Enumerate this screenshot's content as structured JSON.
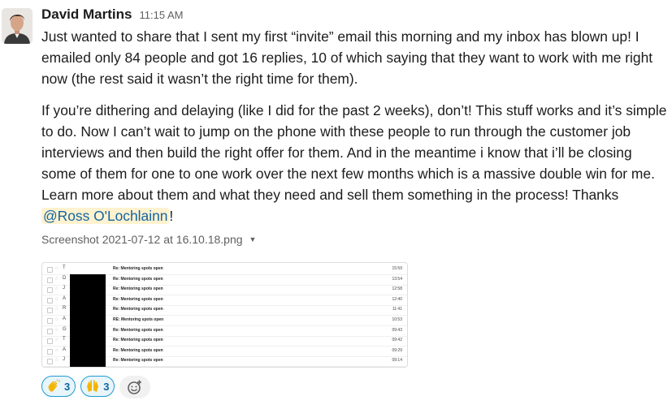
{
  "message": {
    "author": "David Martins",
    "timestamp": "11:15 AM",
    "paragraph1": "Just wanted to share that I sent my first “invite” email this morning and my inbox has blown up! I emailed only 84 people and got 16 replies, 10 of which saying that they want to work with me right now (the rest said it wasn’t the right time for them).",
    "paragraph2": "If you’re dithering and delaying (like I did for the past 2 weeks), don’t! This stuff works and it’s simple to do. Now I can’t wait to jump on the phone with these people to run through the customer job interviews and then build the right offer for them. And in the meantime i know that i’ll be closing some of them for one to one work over the next few months which is a massive double win for me. Learn more about them and what they need and sell them something in the process! Thanks ",
    "mention": "@Ross O'Lochlainn",
    "trailing": "!"
  },
  "attachment": {
    "filename": "Screenshot 2021-07-12 at 16.10.18.png",
    "rows": [
      {
        "init": "T",
        "subject": "Re: Mentoring spots open",
        "time": "15:59"
      },
      {
        "init": "D",
        "subject": "Re: Mentoring spots open",
        "time": "13:54"
      },
      {
        "init": "J",
        "subject": "Re: Mentoring spots open",
        "time": "12:58"
      },
      {
        "init": "A",
        "subject": "Re: Mentoring spots open",
        "time": "12:40"
      },
      {
        "init": "R",
        "subject": "Re: Mentoring spots open",
        "time": "11:41"
      },
      {
        "init": "A",
        "subject": "RE: Mentoring spots open",
        "time": "10:53"
      },
      {
        "init": "G",
        "subject": "Re: Mentoring spots open",
        "time": "09:43"
      },
      {
        "init": "T",
        "subject": "Re: Mentoring spots open",
        "time": "09:42"
      },
      {
        "init": "A",
        "subject": "Re: Mentoring spots open",
        "time": "09:29"
      },
      {
        "init": "J",
        "subject": "Re: Mentoring spots open",
        "time": "09:14"
      }
    ]
  },
  "reactions": [
    {
      "emoji": "clap-emoji",
      "count": "3"
    },
    {
      "emoji": "raised-hands-emoji",
      "count": "3"
    }
  ],
  "colors": {
    "mention_bg": "#fff2cf",
    "mention_text": "#1264a3",
    "reaction_border": "#1d9bd1",
    "reaction_bg": "#e8f5fa"
  }
}
